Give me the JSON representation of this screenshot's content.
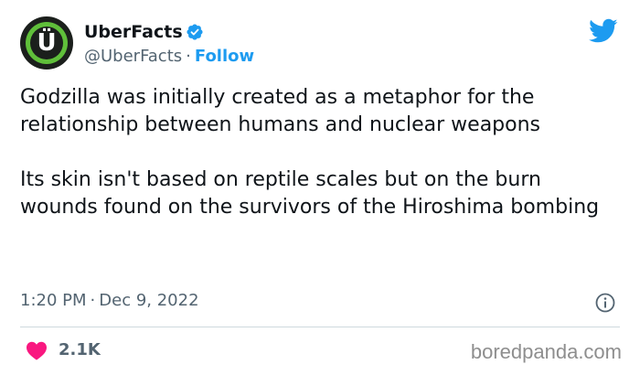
{
  "account": {
    "display_name": "UberFacts",
    "handle": "@UberFacts",
    "separator": "·",
    "follow_label": "Follow",
    "avatar_letter": "Ü",
    "verified_icon": "verified-badge-icon",
    "brand_icon": "twitter-bird-icon"
  },
  "tweet": {
    "paragraphs": [
      "Godzilla was initially created as a metaphor for the relationship between humans and nuclear weapons",
      "Its skin isn't based on reptile scales but on the burn wounds found on the survivors of the Hiroshima bombing"
    ],
    "time": "1:20 PM",
    "date": "Dec 9, 2022",
    "meta_separator": "·",
    "info_icon": "info-icon"
  },
  "engagement": {
    "like_icon": "heart-icon",
    "like_count": "2.1K"
  },
  "watermark": "boredpanda.com",
  "colors": {
    "accent": "#1d9bf0",
    "heart": "#f91880",
    "secondary_text": "#536471",
    "avatar_green": "#5fbf3a"
  }
}
